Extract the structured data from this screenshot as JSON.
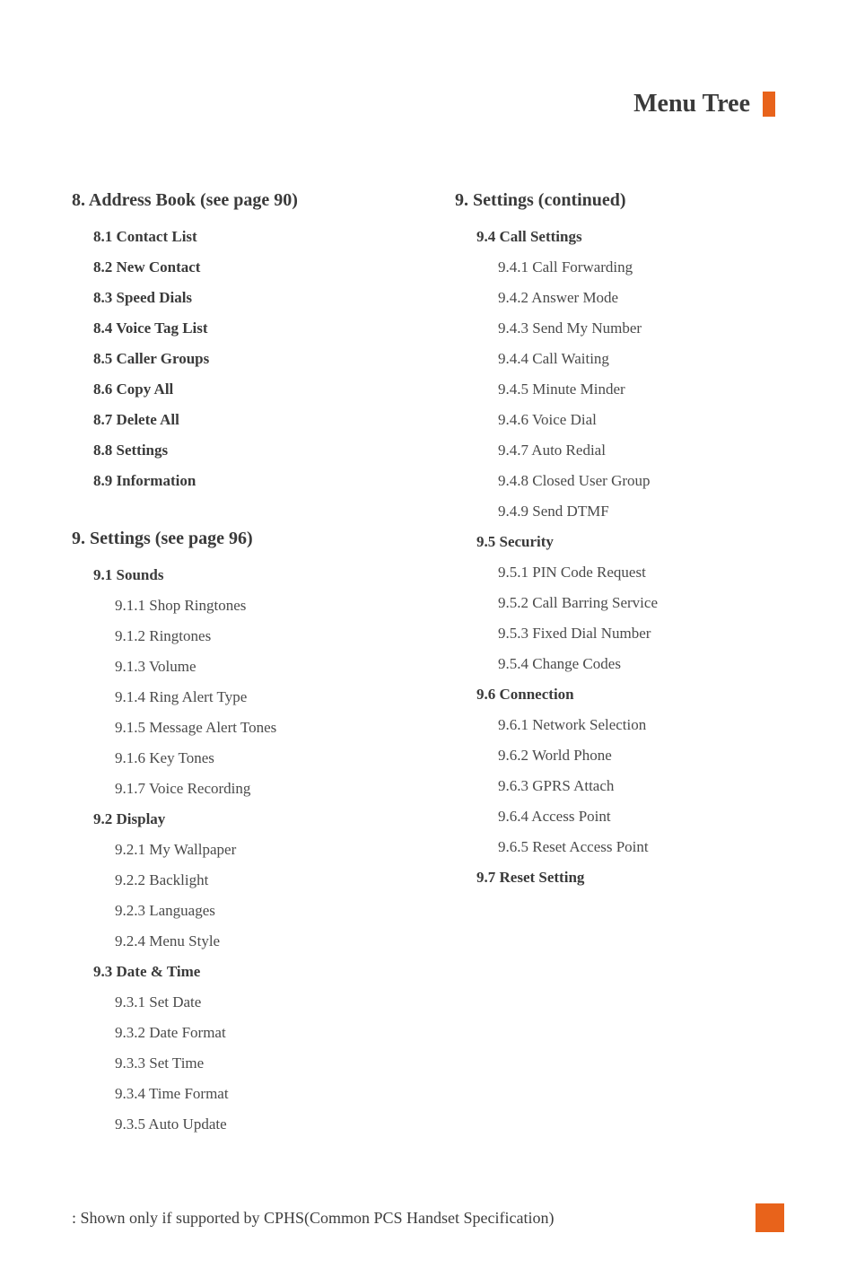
{
  "header": {
    "title": "Menu Tree"
  },
  "left_column": {
    "section8": {
      "title": "8.  Address Book (see page 90)",
      "items": [
        "8.1 Contact List",
        "8.2 New Contact",
        "8.3 Speed Dials",
        "8.4 Voice Tag List",
        "8.5 Caller Groups",
        "8.6 Copy All",
        "8.7 Delete All",
        "8.8 Settings",
        "8.9 Information"
      ]
    },
    "section9": {
      "title": "9.  Settings (see page 96)",
      "sub1": {
        "title": "9.1 Sounds",
        "items": [
          "9.1.1 Shop Ringtones",
          "9.1.2 Ringtones",
          "9.1.3 Volume",
          "9.1.4 Ring Alert Type",
          "9.1.5 Message Alert Tones",
          "9.1.6 Key Tones",
          "9.1.7 Voice Recording"
        ]
      },
      "sub2": {
        "title": "9.2 Display",
        "items": [
          "9.2.1 My Wallpaper",
          "9.2.2 Backlight",
          "9.2.3 Languages",
          "9.2.4 Menu Style"
        ]
      },
      "sub3": {
        "title": "9.3 Date & Time",
        "items": [
          "9.3.1 Set Date",
          "9.3.2 Date Format",
          "9.3.3 Set Time",
          "9.3.4 Time Format",
          "9.3.5 Auto Update"
        ]
      }
    }
  },
  "right_column": {
    "section9cont": {
      "title": "9.  Settings (continued)",
      "sub4": {
        "title": "9.4 Call Settings",
        "items": [
          "9.4.1 Call Forwarding",
          "9.4.2 Answer Mode",
          "9.4.3 Send My Number",
          "9.4.4 Call Waiting",
          "9.4.5 Minute Minder",
          "9.4.6 Voice Dial",
          "9.4.7 Auto Redial",
          "9.4.8 Closed User Group",
          "9.4.9 Send DTMF"
        ]
      },
      "sub5": {
        "title": "9.5 Security",
        "items": [
          "9.5.1 PIN Code Request",
          "9.5.2 Call Barring Service",
          "9.5.3 Fixed Dial Number",
          "9.5.4 Change Codes"
        ]
      },
      "sub6": {
        "title": "9.6 Connection",
        "items": [
          "9.6.1 Network Selection",
          "9.6.2 World Phone",
          "9.6.3 GPRS Attach",
          "9.6.4 Access Point",
          "9.6.5 Reset Access Point"
        ]
      },
      "sub7": {
        "title": "9.7 Reset Setting"
      }
    }
  },
  "footer": {
    "note": ": Shown only if supported by CPHS(Common PCS Handset Specification)"
  }
}
